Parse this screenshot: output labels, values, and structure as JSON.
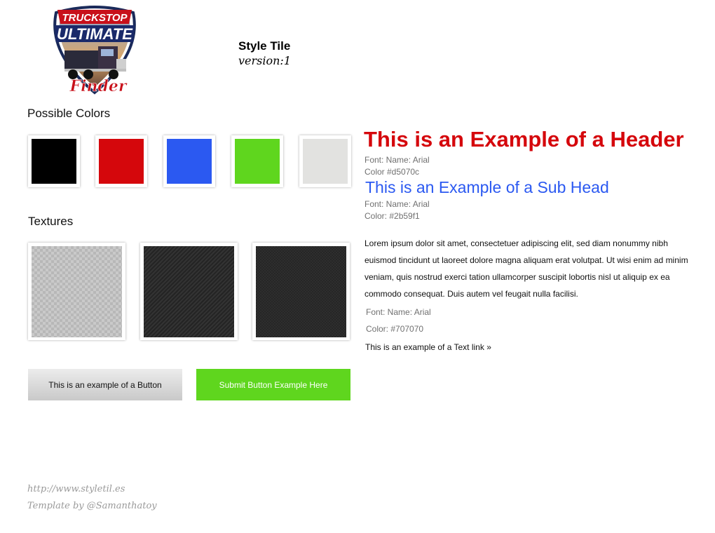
{
  "logo": {
    "line1": "TRUCKSTOP",
    "line2": "ULTIMATE",
    "line3": "Finder"
  },
  "style_tile": {
    "title": "Style Tile",
    "version": "version:1"
  },
  "colors": {
    "label": "Possible Colors",
    "swatches": [
      {
        "name": "black",
        "hex": "#000000"
      },
      {
        "name": "red",
        "hex": "#d5070c"
      },
      {
        "name": "blue",
        "hex": "#2b59f1"
      },
      {
        "name": "green",
        "hex": "#5fd61e"
      },
      {
        "name": "light-gray",
        "hex": "#e2e2e0"
      }
    ]
  },
  "textures": {
    "label": "Textures",
    "items": [
      "light-carbon",
      "dark-diagonal",
      "dark-weave"
    ]
  },
  "buttons": {
    "gray_label": "This is an example of a Button",
    "submit_label": "Submit Button Example Here"
  },
  "typography": {
    "header_text": "This is an Example of a Header",
    "header_font": "Font: Name: Arial",
    "header_color": "Color #d5070c",
    "subhead_text": "This is an Example of a Sub Head",
    "subhead_font": "Font: Name: Arial",
    "subhead_color": "Color: #2b59f1",
    "body_text": "Lorem ipsum dolor sit amet, consectetuer adipiscing elit, sed diam nonummy nibh euismod tincidunt ut laoreet dolore magna aliquam erat volutpat. Ut wisi enim ad minim veniam, quis nostrud exerci tation ullamcorper suscipit lobortis nisl ut aliquip ex ea commodo consequat. Duis autem vel feugait nulla facilisi.",
    "body_font": "Font: Name: Arial",
    "body_color": "Color: #707070",
    "link_text": "This is an example of a Text link »"
  },
  "footer": {
    "url": "http://www.styletil.es",
    "credit": "Template by @Samanthatoy"
  },
  "palette": {
    "header": "#d5070c",
    "subhead": "#2b59f1",
    "meta": "#707070",
    "submit": "#5fd61e"
  }
}
